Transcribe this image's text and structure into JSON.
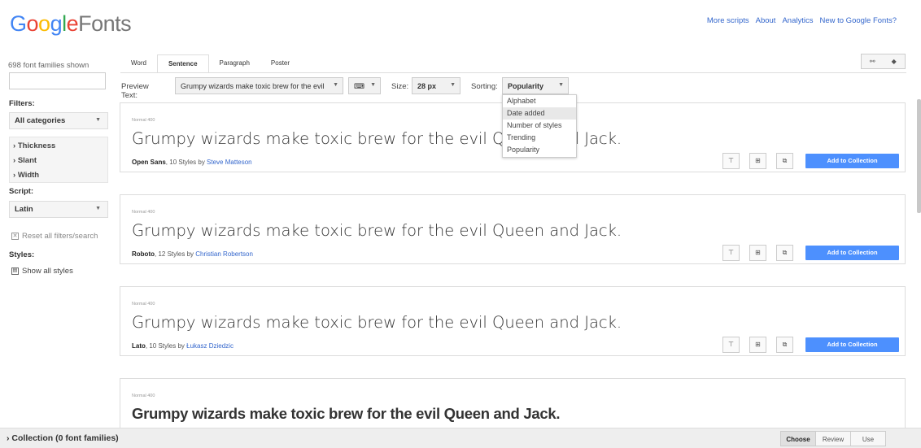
{
  "header": {
    "logo_google": [
      "G",
      "o",
      "o",
      "g",
      "l",
      "e"
    ],
    "logo_fonts": "Fonts",
    "links": [
      "More scripts",
      "About",
      "Analytics",
      "New to Google Fonts?"
    ]
  },
  "sidebar": {
    "count_text": "698 font families shown",
    "search_value": "",
    "filters_label": "Filters:",
    "categories_value": "All categories",
    "filter_items": [
      "Thickness",
      "Slant",
      "Width"
    ],
    "script_label": "Script:",
    "script_value": "Latin",
    "reset_label": "Reset all filters/search",
    "styles_label": "Styles:",
    "show_all_styles": "Show all styles"
  },
  "tabs": [
    "Word",
    "Sentence",
    "Paragraph",
    "Poster"
  ],
  "active_tab": "Sentence",
  "preview": {
    "preview_label": "Preview Text:",
    "preview_value": "Grumpy wizards make toxic brew for the evil",
    "size_label": "Size:",
    "size_value": "28 px",
    "sorting_label": "Sorting:",
    "sorting_value": "Popularity"
  },
  "sort_options": [
    "Alphabet",
    "Date added",
    "Number of styles",
    "Trending",
    "Popularity"
  ],
  "sort_highlighted": "Date added",
  "cards": [
    {
      "weight": "Normal 400",
      "sample": "Grumpy wizards make toxic brew for the evil Queen and Jack.",
      "name": "Open Sans",
      "styles": ", 10 Styles by ",
      "author": "Steve Matteson",
      "add_label": "Add to Collection"
    },
    {
      "weight": "Normal 400",
      "sample": "Grumpy wizards make toxic brew for the evil Queen and Jack.",
      "name": "Roboto",
      "styles": ", 12 Styles by ",
      "author": "Christian Robertson",
      "add_label": "Add to Collection"
    },
    {
      "weight": "Normal 400",
      "sample": "Grumpy wizards make toxic brew for the evil Queen and Jack.",
      "name": "Lato",
      "styles": ", 10 Styles by ",
      "author": "Łukasz Dziedzic",
      "add_label": "Add to Collection"
    },
    {
      "weight": "Normal 400",
      "sample": "Grumpy wizards make toxic brew for the evil Queen and Jack."
    }
  ],
  "footer": {
    "collection_label": "Collection (0 font families)",
    "buttons": [
      "Choose",
      "Review",
      "Use"
    ],
    "active_button": "Choose"
  }
}
